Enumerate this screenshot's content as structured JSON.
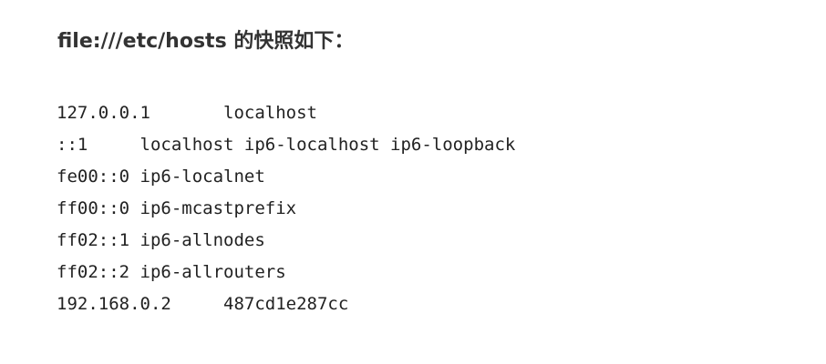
{
  "heading": "file:///etc/hosts 的快照如下：",
  "hosts_lines": [
    "127.0.0.1\tlocalhost",
    "::1\tlocalhost ip6-localhost ip6-loopback",
    "fe00::0\tip6-localnet",
    "ff00::0\tip6-mcastprefix",
    "ff02::1\tip6-allnodes",
    "ff02::2\tip6-allrouters",
    "192.168.0.2\t487cd1e287cc"
  ]
}
